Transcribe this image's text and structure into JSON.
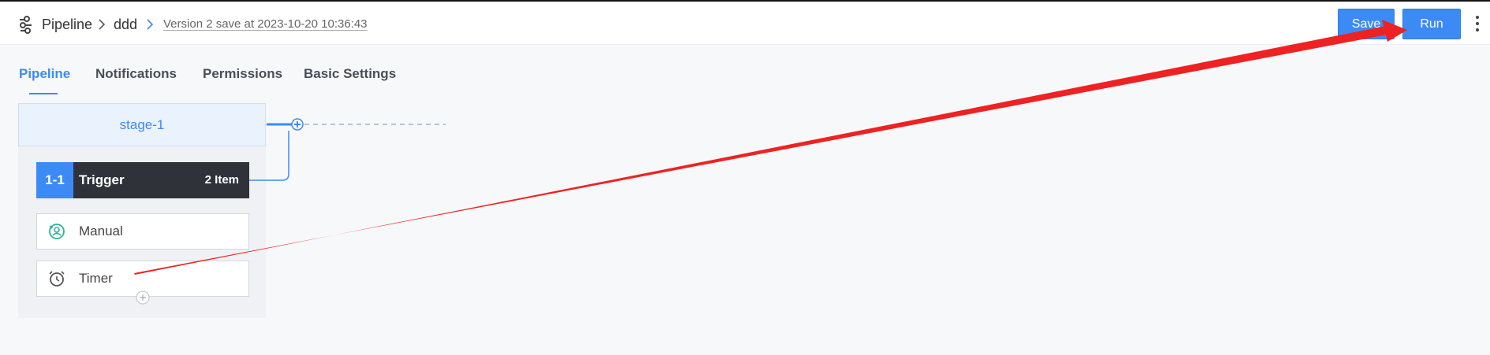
{
  "header": {
    "breadcrumb": [
      "Pipeline",
      "ddd"
    ],
    "version_text": "Version 2 save at 2023-10-20 10:36:43",
    "save_label": "Save",
    "run_label": "Run",
    "logo_icon": "pipeline-logo-icon",
    "more_icon": "more-vertical-icon"
  },
  "tabs": [
    {
      "label": "Pipeline",
      "active": true
    },
    {
      "label": "Notifications",
      "active": false
    },
    {
      "label": "Permissions",
      "active": false
    },
    {
      "label": "Basic Settings",
      "active": false
    }
  ],
  "stage": {
    "name": "stage-1",
    "job": {
      "number": "1-1",
      "name": "Trigger",
      "count": "2 Item"
    },
    "items": [
      {
        "label": "Manual",
        "icon": "manual-user-icon"
      },
      {
        "label": "Timer",
        "icon": "alarm-clock-icon"
      }
    ]
  },
  "colors": {
    "accent": "#3c8af5",
    "job_background": "#2f3339",
    "annotation_arrow": "#ee2222"
  }
}
